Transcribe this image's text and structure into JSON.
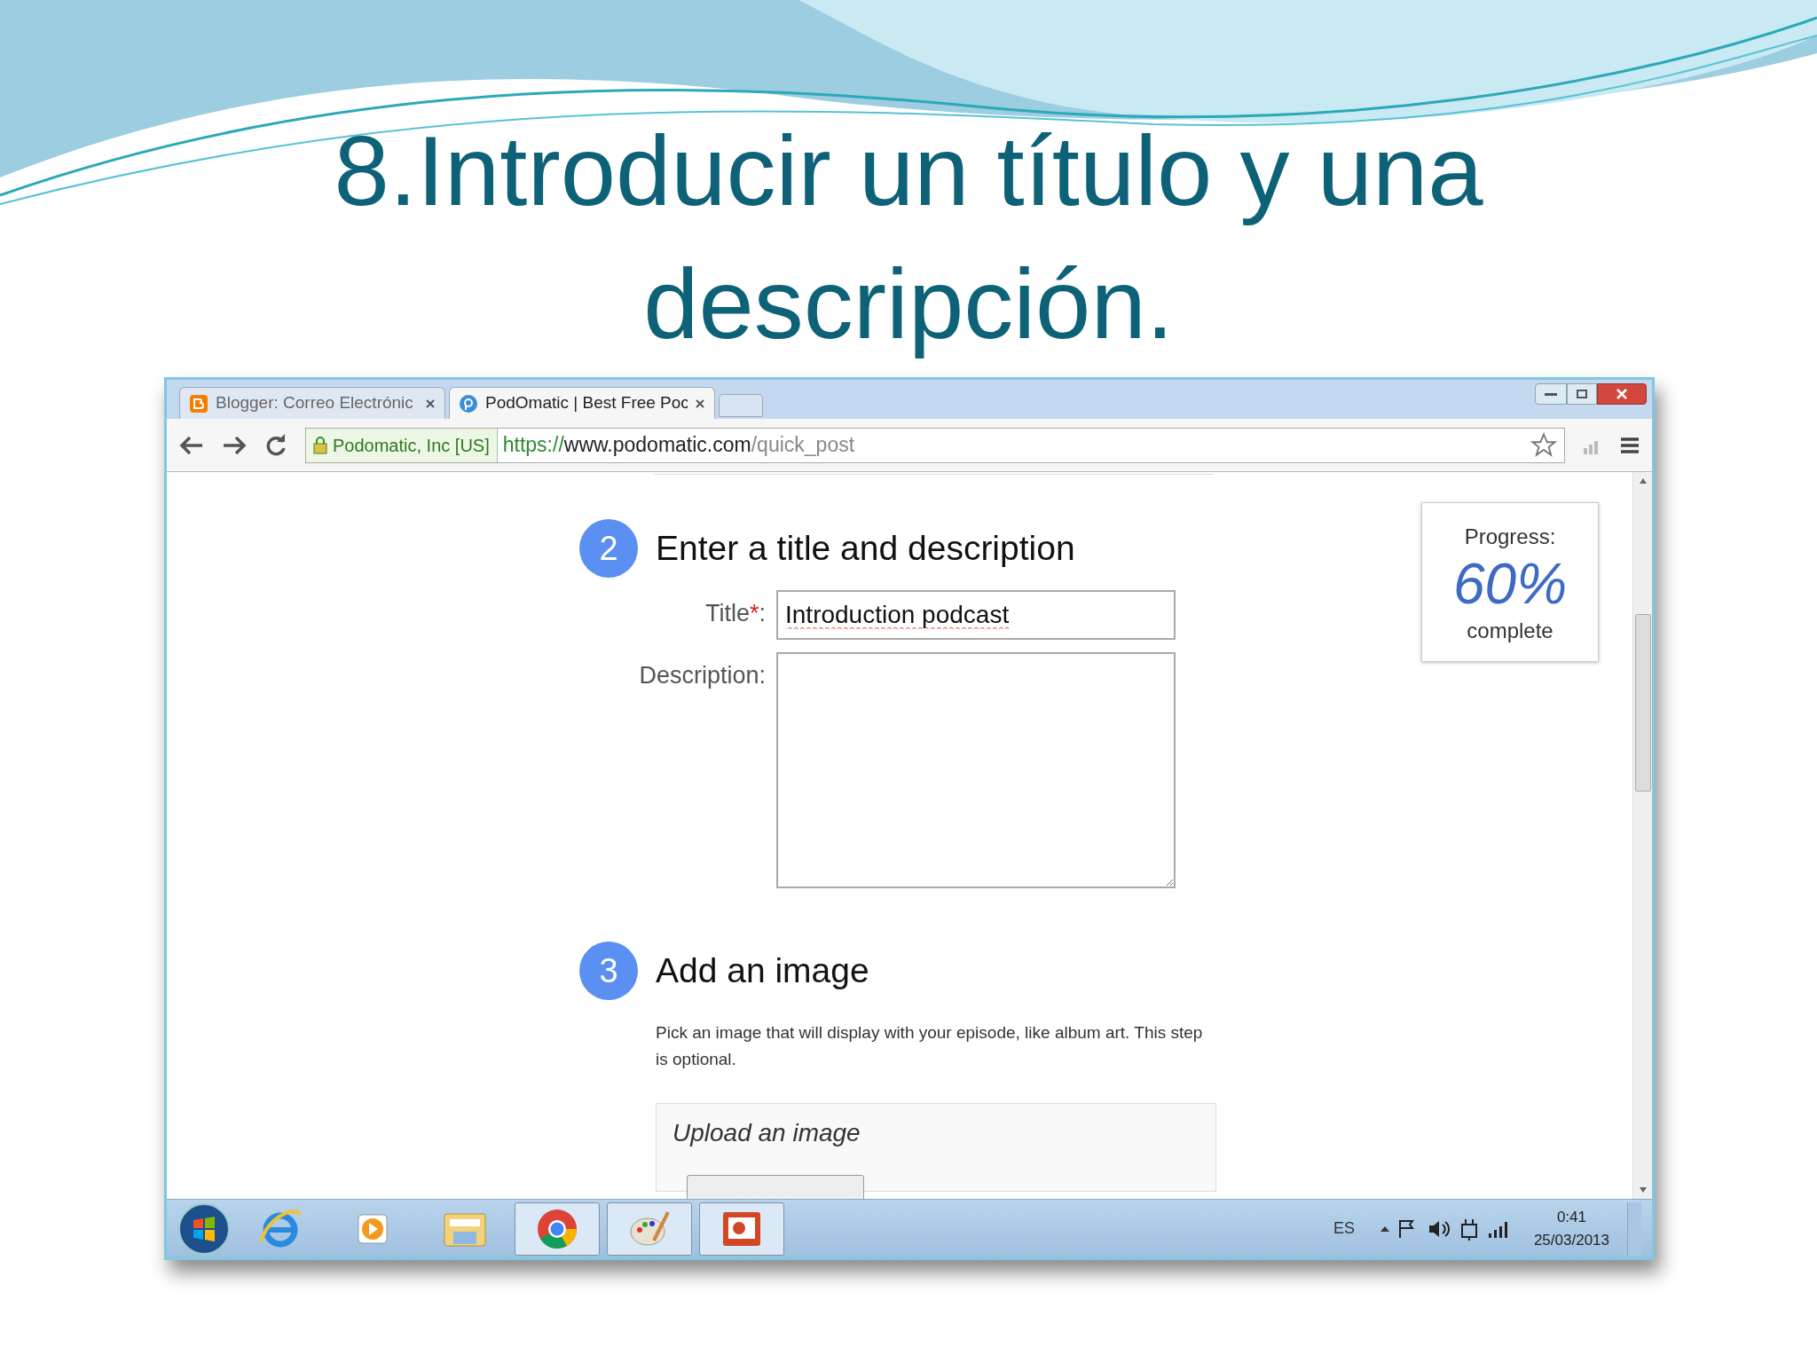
{
  "slide": {
    "title_lines": [
      "8.Introducir un título y una",
      "descripción."
    ]
  },
  "browser": {
    "tabs": [
      {
        "label": "Blogger: Correo Electrónic",
        "selected": false,
        "kind": "blogger"
      },
      {
        "label": "PodOmatic | Best Free Poc",
        "selected": true,
        "kind": "podomatic"
      }
    ],
    "address_bar": {
      "identity": "Podomatic, Inc [US]",
      "scheme": "https://",
      "host": "www.podomatic.com",
      "path": "/quick_post"
    }
  },
  "page": {
    "steps": [
      {
        "number": "2",
        "title": "Enter a title and description",
        "kind": "form",
        "fields": [
          {
            "kind": "input",
            "label": "Title",
            "required_mark": "*",
            "label_end": ":",
            "value": "Introduction podcast"
          },
          {
            "kind": "textarea",
            "label": "Description:"
          }
        ]
      },
      {
        "number": "3",
        "title": "Add an image",
        "kind": "upload",
        "text": "Pick an image that will display with your episode, like album art. This step is optional.",
        "panel_title": "Upload an image"
      }
    ],
    "progress": {
      "label": "Progress:",
      "value": "60%",
      "suffix": "complete"
    }
  },
  "taskbar": {
    "apps": [
      {
        "kind": "ie",
        "selected": false
      },
      {
        "kind": "media",
        "selected": false
      },
      {
        "kind": "explorer",
        "selected": false
      },
      {
        "kind": "chrome",
        "selected": true
      },
      {
        "kind": "paint",
        "selected": true
      },
      {
        "kind": "powerpoint",
        "selected": true
      }
    ],
    "language": "ES",
    "time": "0:41",
    "date": "25/03/2013"
  }
}
